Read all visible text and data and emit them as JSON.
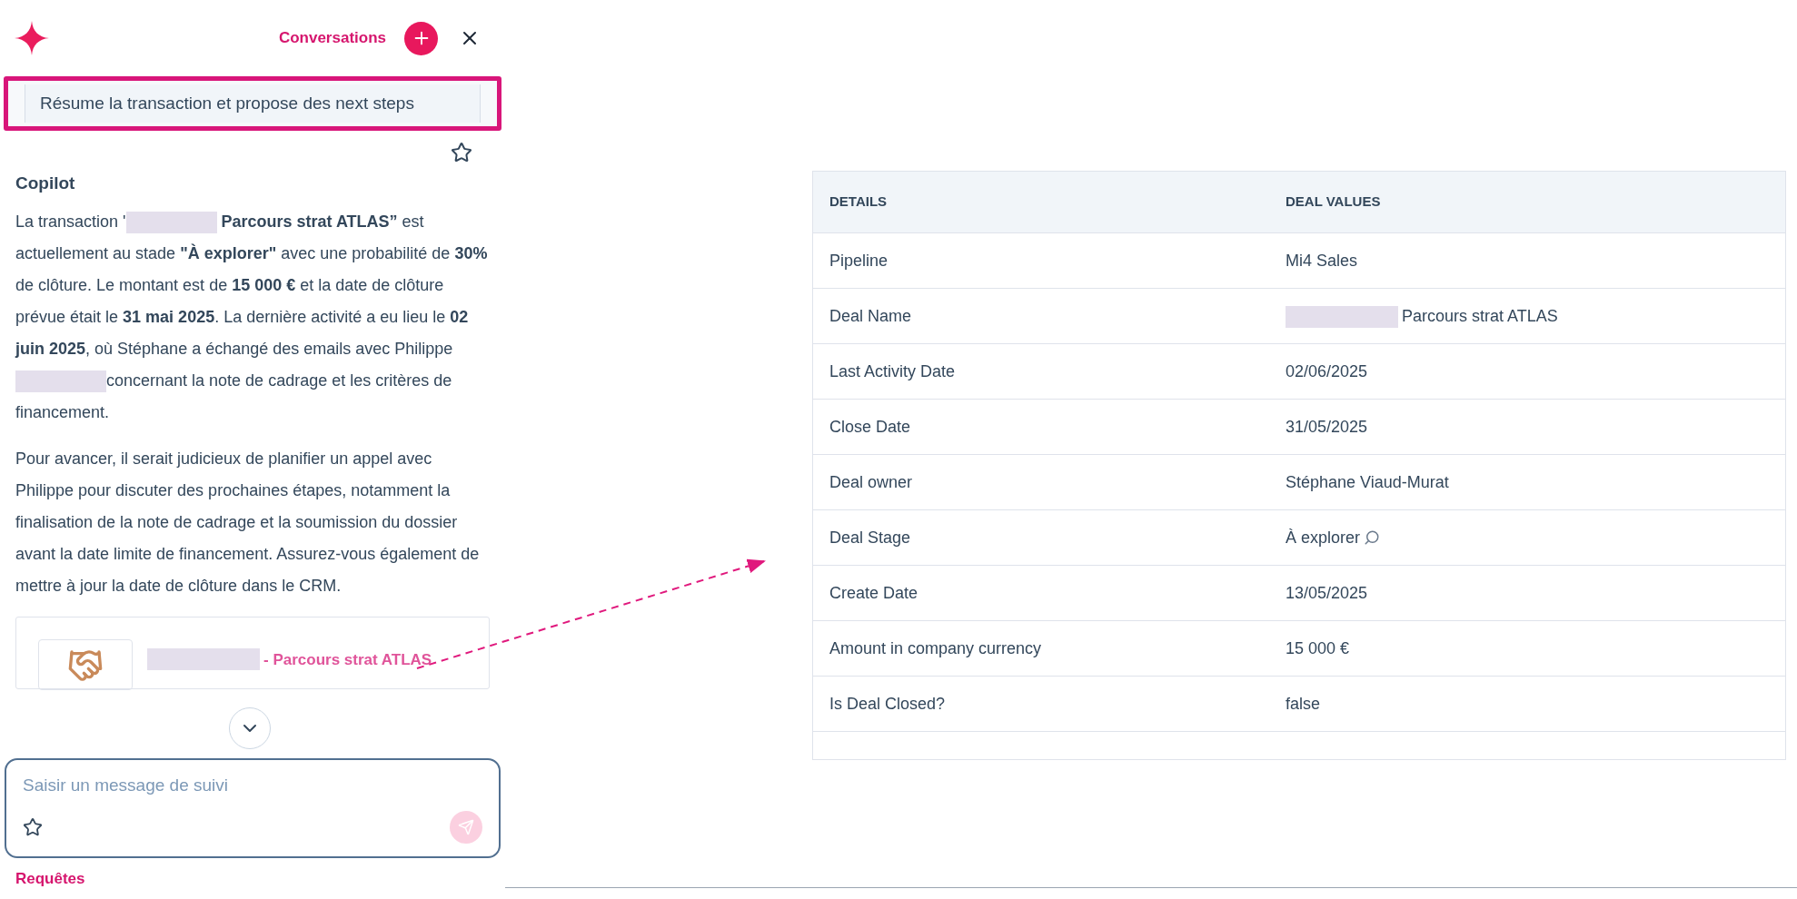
{
  "header": {
    "link": "Conversations"
  },
  "prompt": "Résume la transaction et propose des next steps",
  "response": {
    "title": "Copilot",
    "paragraphs": [
      [
        {
          "kind": "text",
          "text": "La transaction '"
        },
        {
          "kind": "redacted"
        },
        {
          "kind": "text",
          "text": " **Parcours strat ATLAS”** est actuellement au stade **\"À explorer\"** avec une probabilité de **30%** de clôture. Le montant est de **15 000 €** et la date de clôture prévue était le **31 mai 2025**. La dernière activité a eu lieu le **02 juin 2025**, où Stéphane a échangé des emails avec Philippe "
        },
        {
          "kind": "redacted"
        },
        {
          "kind": "text",
          "text": "concernant la note de cadrage et les critères de financement."
        }
      ],
      [
        {
          "kind": "text",
          "text": "Pour avancer, il serait judicieux de planifier un appel avec Philippe pour discuter des prochaines étapes, notamment la finalisation de la note de cadrage et la soumission du dossier avant la date limite de financement. Assurez-vous également de mettre à jour la date de clôture dans le CRM."
        }
      ]
    ]
  },
  "record_card": {
    "title": "- Parcours strat ATLAS"
  },
  "composer": {
    "placeholder": "Saisir un message de suivi"
  },
  "footer_link": "Requêtes",
  "table": {
    "columns": [
      "DETAILS",
      "DEAL VALUES"
    ],
    "rows": [
      {
        "kind": "plain",
        "label": "Pipeline",
        "value": "Mi4 Sales"
      },
      {
        "kind": "redacted",
        "label": "Deal Name",
        "value": "Parcours strat ATLAS"
      },
      {
        "kind": "plain",
        "label": "Last Activity Date",
        "value": "02/06/2025"
      },
      {
        "kind": "plain",
        "label": "Close Date",
        "value": "31/05/2025"
      },
      {
        "kind": "plain",
        "label": "Deal owner",
        "value": "Stéphane Viaud-Murat"
      },
      {
        "kind": "stage",
        "label": "Deal Stage",
        "value": "À explorer"
      },
      {
        "kind": "plain",
        "label": "Create Date",
        "value": "13/05/2025"
      },
      {
        "kind": "plain",
        "label": "Amount in company currency",
        "value": "15 000 €"
      },
      {
        "kind": "plain",
        "label": "Is Deal Closed?",
        "value": "false"
      }
    ]
  }
}
